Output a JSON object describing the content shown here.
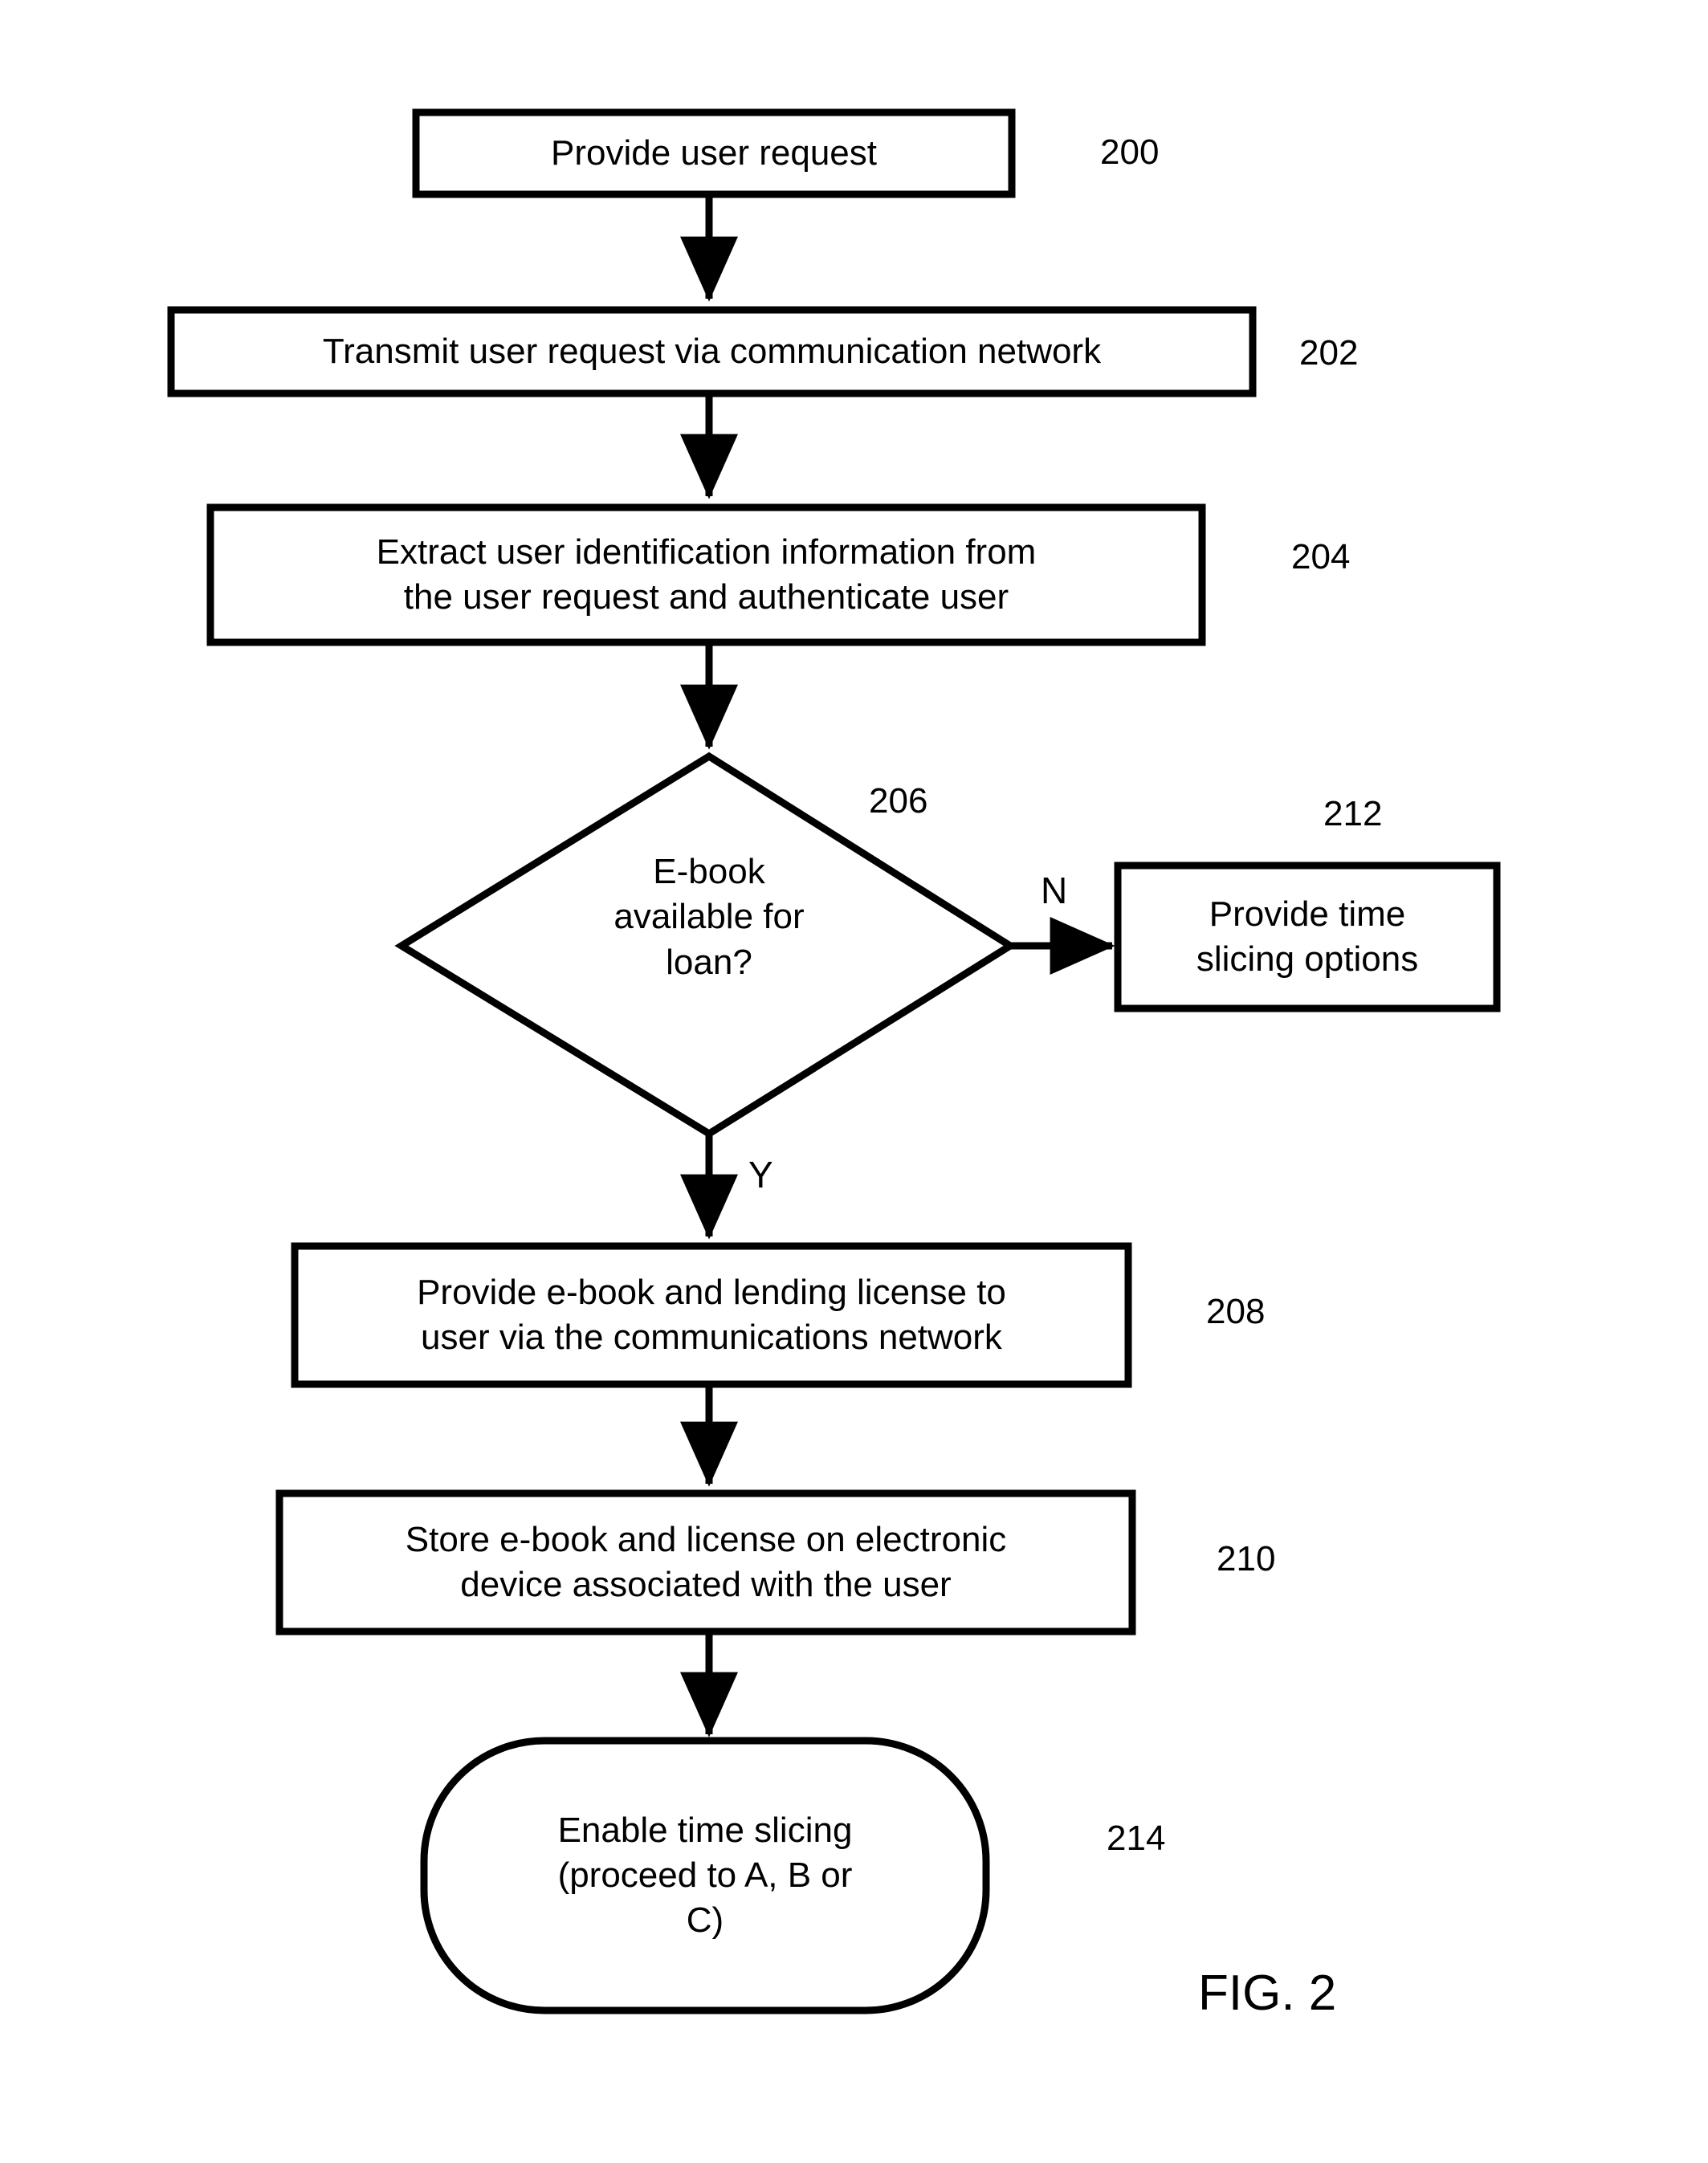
{
  "figure": {
    "caption": "FIG. 2",
    "background_color": "#ffffff",
    "stroke_color": "#000000"
  },
  "nodes": [
    {
      "id": "200",
      "shape": "process",
      "text": "Provide user request",
      "ref": "200"
    },
    {
      "id": "202",
      "shape": "process",
      "text": "Transmit user request via communication network",
      "ref": "202"
    },
    {
      "id": "204",
      "shape": "process",
      "text": "Extract user identification information from\nthe user request and authenticate user",
      "ref": "204"
    },
    {
      "id": "206",
      "shape": "decision",
      "text": "E-book\navailable for\nloan?",
      "ref": "206"
    },
    {
      "id": "212",
      "shape": "process",
      "text": "Provide time\nslicing options",
      "ref": "212"
    },
    {
      "id": "208",
      "shape": "process",
      "text": "Provide e-book and lending license to\nuser via the communications network",
      "ref": "208"
    },
    {
      "id": "210",
      "shape": "process",
      "text": "Store e-book and license on electronic\ndevice associated with the user",
      "ref": "210"
    },
    {
      "id": "214",
      "shape": "terminator",
      "text": "Enable time slicing\n(proceed to A, B or\nC)",
      "ref": "214"
    }
  ],
  "edges": [
    {
      "from": "200",
      "to": "202",
      "label": ""
    },
    {
      "from": "202",
      "to": "204",
      "label": ""
    },
    {
      "from": "204",
      "to": "206",
      "label": ""
    },
    {
      "from": "206",
      "to": "212",
      "label": "N"
    },
    {
      "from": "206",
      "to": "208",
      "label": "Y"
    },
    {
      "from": "208",
      "to": "210",
      "label": ""
    },
    {
      "from": "210",
      "to": "214",
      "label": ""
    }
  ],
  "branch_labels": {
    "no": "N",
    "yes": "Y"
  }
}
